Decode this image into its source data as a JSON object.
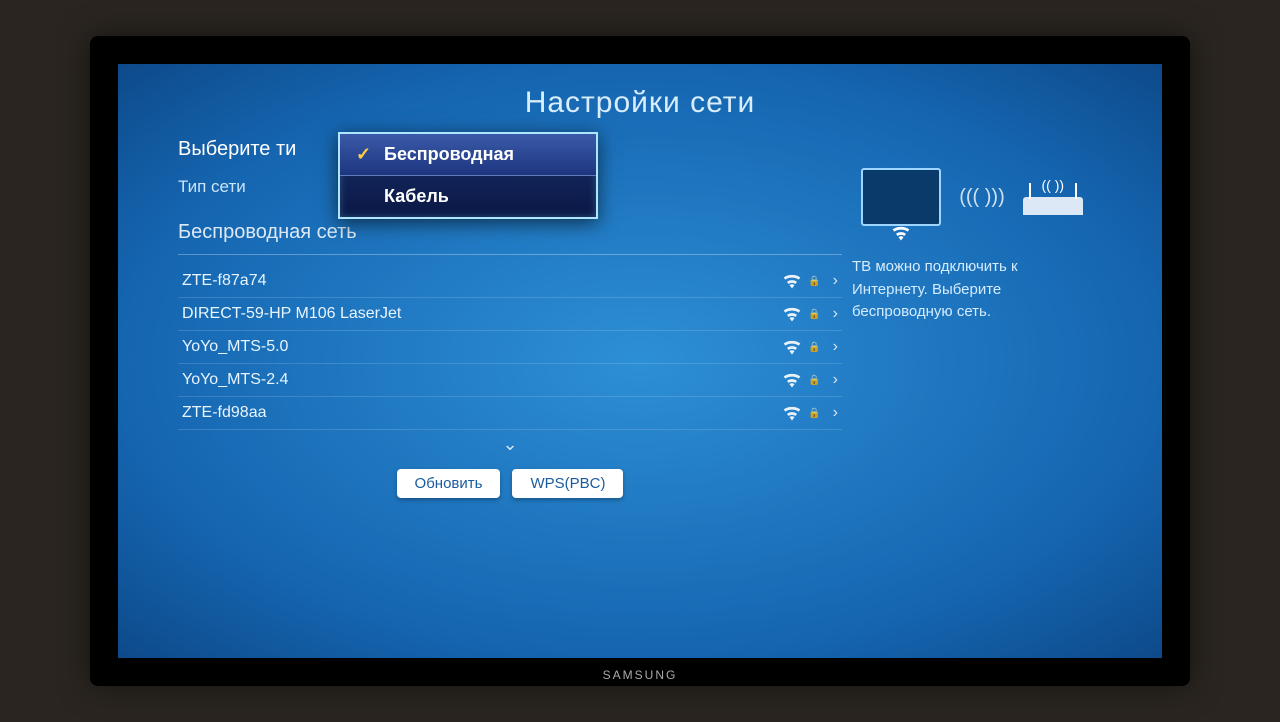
{
  "brand": "SAMSUNG",
  "title": "Настройки сети",
  "subtitle": "Выберите ти",
  "type_label": "Тип сети",
  "section_header": "Беспроводная сеть",
  "popup": {
    "options": [
      {
        "label": "Беспроводная",
        "selected": true
      },
      {
        "label": "Кабель",
        "selected": false
      }
    ]
  },
  "networks": [
    {
      "name": "ZTE-f87a74",
      "locked": true
    },
    {
      "name": "DIRECT-59-HP M106 LaserJet",
      "locked": true
    },
    {
      "name": "YoYo_MTS-5.0",
      "locked": true
    },
    {
      "name": "YoYo_MTS-2.4",
      "locked": true
    },
    {
      "name": "ZTE-fd98aa",
      "locked": true
    }
  ],
  "buttons": {
    "refresh": "Обновить",
    "wps": "WPS(PBC)"
  },
  "help_text": "ТВ можно подключить к Интернету. Выберите беспроводную сеть."
}
